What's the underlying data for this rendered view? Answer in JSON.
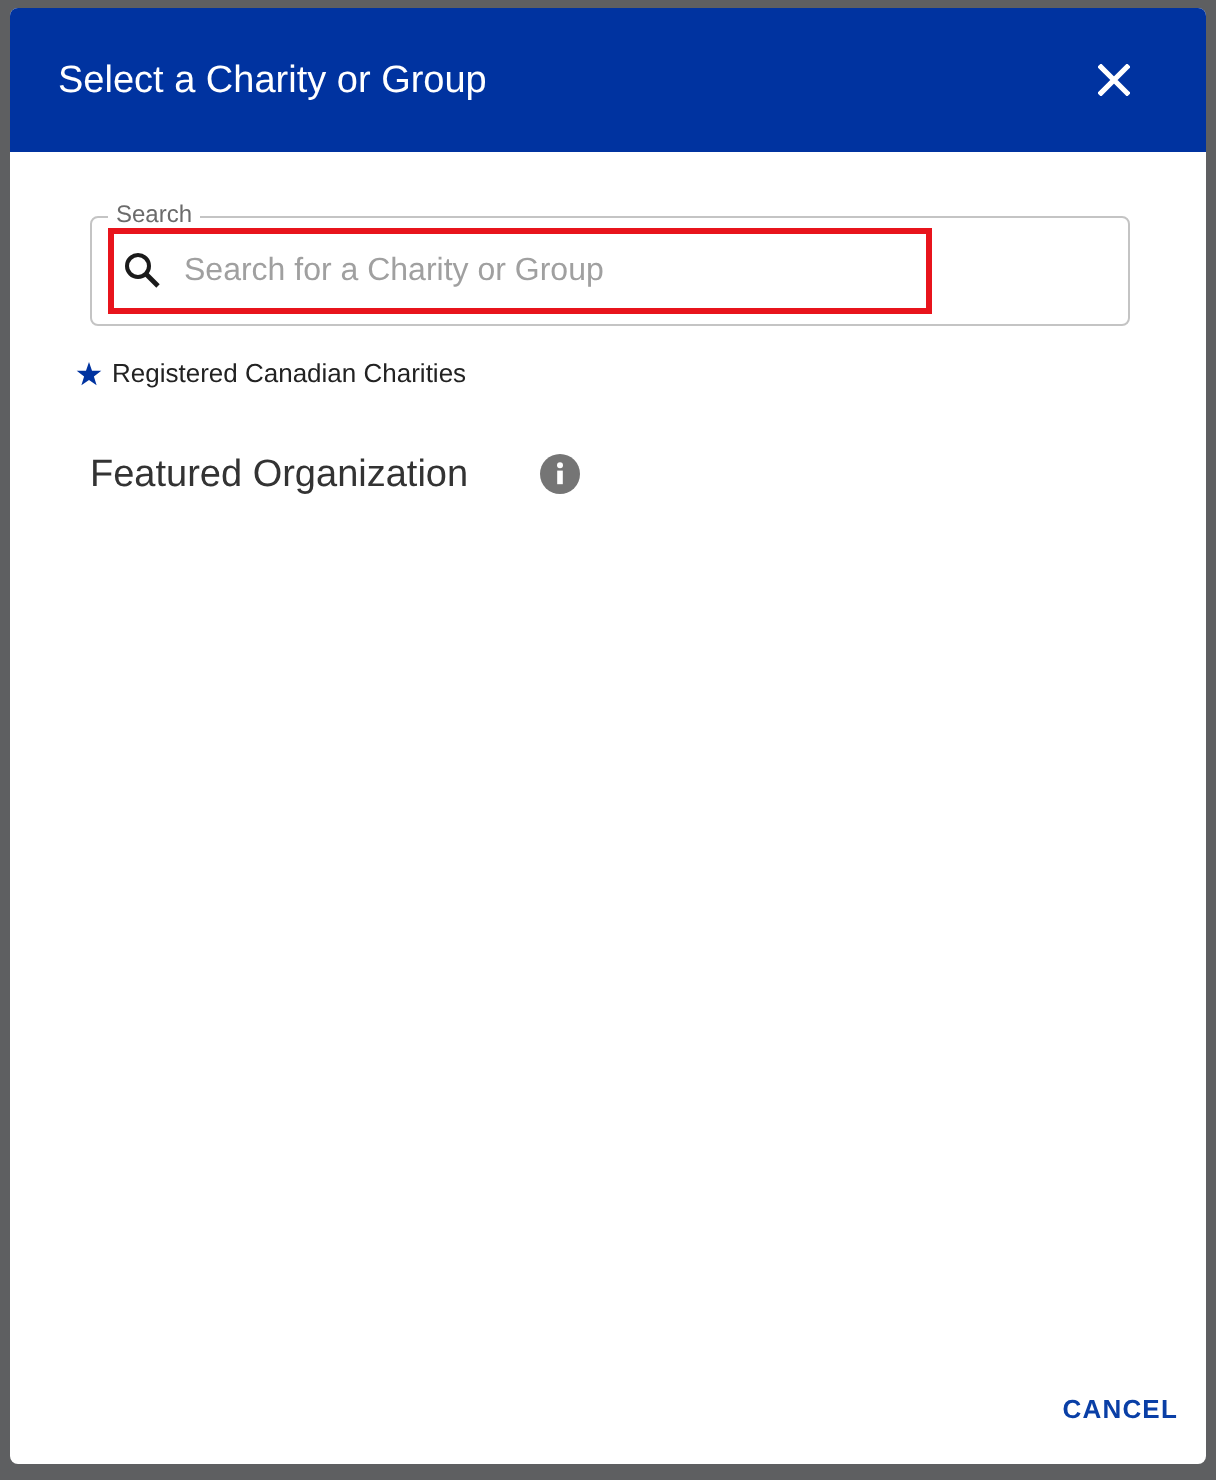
{
  "dialog": {
    "title": "Select a Charity or Group"
  },
  "search": {
    "label": "Search",
    "placeholder": "Search for a Charity or Group",
    "highlighted": true
  },
  "legend": {
    "text": "Registered Canadian Charities"
  },
  "featured": {
    "heading": "Featured Organization"
  },
  "buttons": [
    {
      "label": "CANCEL",
      "kind": "text"
    }
  ]
}
